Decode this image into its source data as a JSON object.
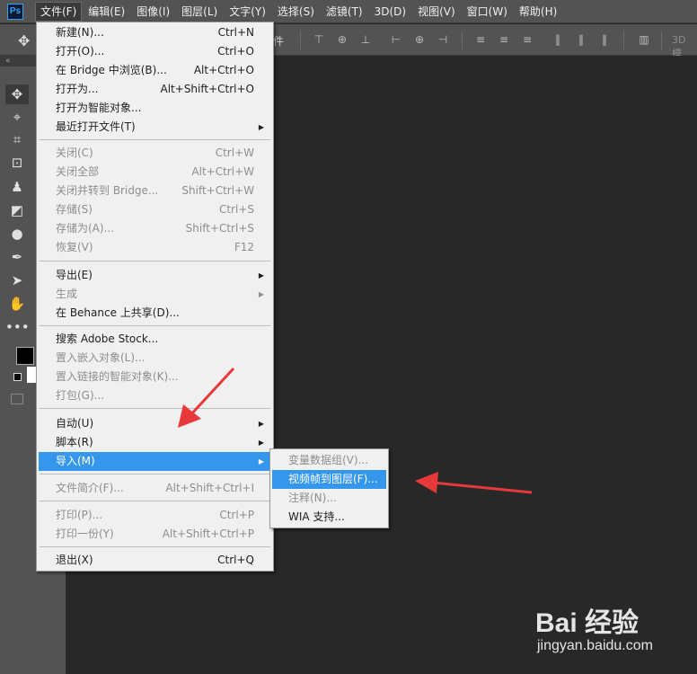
{
  "menubar": {
    "logo": "Ps",
    "items": [
      "文件(F)",
      "编辑(E)",
      "图像(I)",
      "图层(L)",
      "文字(Y)",
      "选择(S)",
      "滤镜(T)",
      "3D(D)",
      "视图(V)",
      "窗口(W)",
      "帮助(H)"
    ]
  },
  "options": {
    "fragment": "件",
    "label_3d": "3D 模"
  },
  "file_menu": {
    "items": [
      {
        "label": "新建(N)...",
        "shortcut": "Ctrl+N"
      },
      {
        "label": "打开(O)...",
        "shortcut": "Ctrl+O"
      },
      {
        "label": "在 Bridge 中浏览(B)...",
        "shortcut": "Alt+Ctrl+O"
      },
      {
        "label": "打开为...",
        "shortcut": "Alt+Shift+Ctrl+O"
      },
      {
        "label": "打开为智能对象...",
        "shortcut": ""
      },
      {
        "label": "最近打开文件(T)",
        "shortcut": ""
      },
      {
        "label": "关闭(C)",
        "shortcut": "Ctrl+W"
      },
      {
        "label": "关闭全部",
        "shortcut": "Alt+Ctrl+W"
      },
      {
        "label": "关闭并转到 Bridge...",
        "shortcut": "Shift+Ctrl+W"
      },
      {
        "label": "存储(S)",
        "shortcut": "Ctrl+S"
      },
      {
        "label": "存储为(A)...",
        "shortcut": "Shift+Ctrl+S"
      },
      {
        "label": "恢复(V)",
        "shortcut": "F12"
      },
      {
        "label": "导出(E)",
        "shortcut": ""
      },
      {
        "label": "生成",
        "shortcut": ""
      },
      {
        "label": "在 Behance 上共享(D)...",
        "shortcut": ""
      },
      {
        "label": "搜索 Adobe Stock...",
        "shortcut": ""
      },
      {
        "label": "置入嵌入对象(L)...",
        "shortcut": ""
      },
      {
        "label": "置入链接的智能对象(K)...",
        "shortcut": ""
      },
      {
        "label": "打包(G)...",
        "shortcut": ""
      },
      {
        "label": "自动(U)",
        "shortcut": ""
      },
      {
        "label": "脚本(R)",
        "shortcut": ""
      },
      {
        "label": "导入(M)",
        "shortcut": ""
      },
      {
        "label": "文件简介(F)...",
        "shortcut": "Alt+Shift+Ctrl+I"
      },
      {
        "label": "打印(P)...",
        "shortcut": "Ctrl+P"
      },
      {
        "label": "打印一份(Y)",
        "shortcut": "Alt+Shift+Ctrl+P"
      },
      {
        "label": "退出(X)",
        "shortcut": "Ctrl+Q"
      }
    ]
  },
  "import_submenu": {
    "items": [
      "变量数据组(V)...",
      "视频帧到图层(F)...",
      "注释(N)...",
      "WIA 支持..."
    ]
  },
  "watermark": {
    "logo": "Bai 经验",
    "url": "jingyan.baidu.com"
  },
  "colors": {
    "highlight": "#3597ec",
    "arrow": "#e8393a"
  }
}
